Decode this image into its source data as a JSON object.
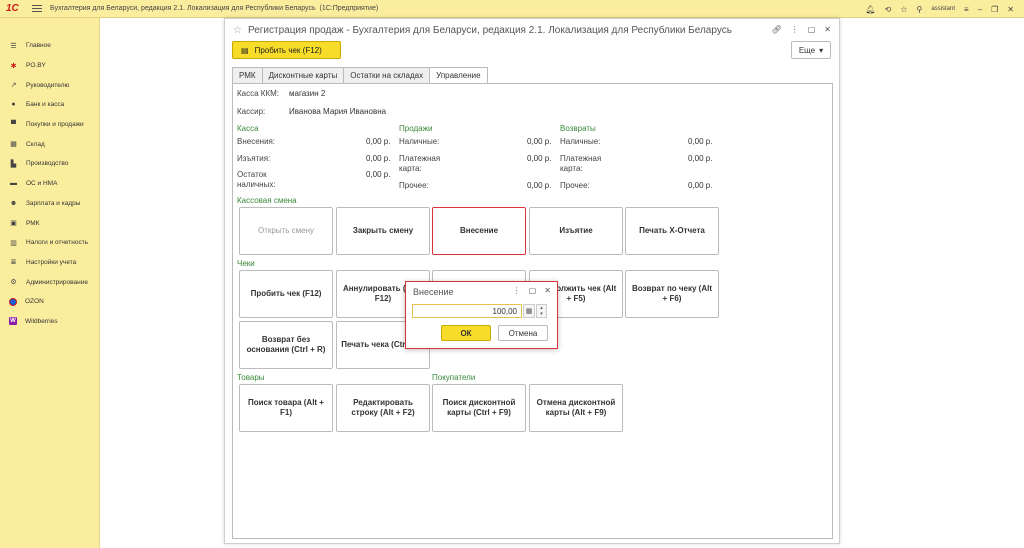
{
  "app": {
    "logo": "1С",
    "title": "Бухгалтерия для Беларуси, редакция 2.1. Локализация для Республики Беларусь",
    "mode": "(1С:Предприятие)",
    "user": "assistant"
  },
  "sidebar": {
    "items": [
      {
        "label": "Главное",
        "icon": "menu-icon"
      },
      {
        "label": "PO.BY",
        "icon": "star-icon"
      },
      {
        "label": "Руководителю",
        "icon": "trend-icon"
      },
      {
        "label": "Банк и касса",
        "icon": "bank-icon"
      },
      {
        "label": "Покупки и продажи",
        "icon": "cart-icon"
      },
      {
        "label": "Склад",
        "icon": "warehouse-icon"
      },
      {
        "label": "Производство",
        "icon": "factory-icon"
      },
      {
        "label": "ОС и НМА",
        "icon": "truck-icon"
      },
      {
        "label": "Зарплата и кадры",
        "icon": "people-icon"
      },
      {
        "label": "РМК",
        "icon": "register-icon"
      },
      {
        "label": "Налоги и отчетность",
        "icon": "chart-icon"
      },
      {
        "label": "Настройки учета",
        "icon": "list-icon"
      },
      {
        "label": "Администрирование",
        "icon": "gear-icon"
      },
      {
        "label": "OZON",
        "icon": "ozon-icon"
      },
      {
        "label": "Wildberries",
        "icon": "wb-icon"
      }
    ]
  },
  "window": {
    "title": "Регистрация продаж - Бухгалтерия для Беларуси, редакция 2.1. Локализация для Республики Беларусь",
    "punch_button": "Пробить чек (F12)",
    "more_button": "Еще",
    "tabs": [
      "РМК",
      "Дисконтные карты",
      "Остатки на складах",
      "Управление"
    ]
  },
  "panel": {
    "kkm_label": "Касса ККМ:",
    "kkm_value": "магазин 2",
    "cashier_label": "Кассир:",
    "cashier_value": "Иванова Мария Ивановна",
    "kassa": {
      "title": "Касса",
      "deposits_label": "Внесения:",
      "deposits_value": "0,00 р.",
      "withdrawals_label": "Изъятия:",
      "withdrawals_value": "0,00 р.",
      "cash_rest_label": "Остаток наличных:",
      "cash_rest_value": "0,00 р."
    },
    "sales": {
      "title": "Продажи",
      "cash_label": "Наличные:",
      "cash_value": "0,00 р.",
      "card_label": "Платежная карта:",
      "card_value": "0,00 р.",
      "other_label": "Прочее:",
      "other_value": "0,00 р."
    },
    "returns": {
      "title": "Возвраты",
      "cash_label": "Наличные:",
      "cash_value": "0,00 р.",
      "card_label": "Платежная карта:",
      "card_value": "0,00 р.",
      "other_label": "Прочее:",
      "other_value": "0,00 р."
    },
    "shift": {
      "title": "Кассовая смена",
      "buttons": [
        "Открыть смену",
        "Закрыть смену",
        "Внесение",
        "Изъятие",
        "Печать X-Отчета"
      ]
    },
    "checks": {
      "title": "Чеки",
      "buttons": [
        "Пробить чек (F12)",
        "Аннулировать (Alt + F12)",
        "",
        "Продолжить чек (Alt + F5)",
        "Возврат по чеку (Alt + F6)",
        "Возврат без основания (Ctrl + R)",
        "Печать чека (Ctrl + P)"
      ]
    },
    "goods": {
      "title": "Товары",
      "buttons": [
        "Поиск товара (Alt + F1)",
        "Редактировать строку (Alt + F2)"
      ]
    },
    "buyers": {
      "title": "Покупатели",
      "buttons": [
        "Поиск дисконтной карты (Ctrl + F9)",
        "Отмена дисконтной карты (Alt + F9)"
      ]
    }
  },
  "dialog": {
    "title": "Внесение",
    "amount": "100,00",
    "ok": "ОК",
    "cancel": "Отмена"
  }
}
